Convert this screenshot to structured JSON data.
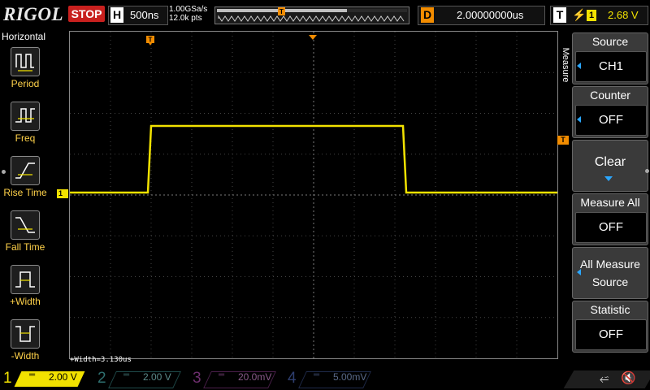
{
  "brand": "RIGOL",
  "status": "STOP",
  "horizontal": {
    "label": "H",
    "timebase": "500ns"
  },
  "sample": {
    "rate": "1.00GSa/s",
    "points": "12.0k pts"
  },
  "delay": {
    "label": "D",
    "value": "2.00000000us"
  },
  "trigger": {
    "label": "T",
    "edge_icon": "rising-edge-icon",
    "channel": "1",
    "level": "2.68 V"
  },
  "left_menu": {
    "title": "Horizontal",
    "items": [
      {
        "label": "Period",
        "icon": "period-icon"
      },
      {
        "label": "Freq",
        "icon": "frequency-icon"
      },
      {
        "label": "Rise Time",
        "icon": "rise-time-icon"
      },
      {
        "label": "Fall Time",
        "icon": "fall-time-icon"
      },
      {
        "label": "+Width",
        "icon": "positive-width-icon"
      },
      {
        "label": "-Width",
        "icon": "negative-width-icon"
      }
    ]
  },
  "right_menu": {
    "tab": "Measure",
    "items": [
      {
        "title": "Source",
        "value": "CH1"
      },
      {
        "title": "Counter",
        "value": "OFF"
      },
      {
        "title": "",
        "value": "Clear"
      },
      {
        "title": "Measure All",
        "value": "OFF"
      },
      {
        "title": "All Measure",
        "value": "Source"
      },
      {
        "title": "Statistic",
        "value": "OFF"
      }
    ]
  },
  "waveform": {
    "channel_marker": "1",
    "trigger_level_marker": "T",
    "trigger_position_marker": "T",
    "measurement": "+Width=3.130us",
    "color": "#f2e200"
  },
  "channels": [
    {
      "num": "1",
      "scale": "2.00 V",
      "color": "#f2e200",
      "active": true
    },
    {
      "num": "2",
      "scale": "2.00 V",
      "color": "#2ec4c4",
      "active": false
    },
    {
      "num": "3",
      "scale": "20.0mV",
      "color": "#d43cd4",
      "active": false
    },
    {
      "num": "4",
      "scale": "5.00mV",
      "color": "#3b6bff",
      "active": false
    }
  ],
  "colors": {
    "trigger_accent": "#f28c00",
    "stop_bg": "#c8201e",
    "menu_highlight": "#2aa7ff"
  }
}
